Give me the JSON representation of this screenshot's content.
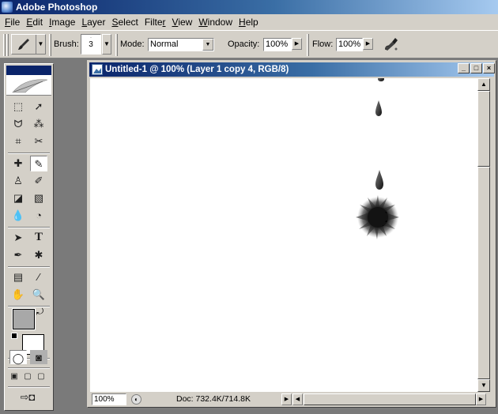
{
  "app": {
    "title": "Adobe Photoshop"
  },
  "menu": [
    {
      "pre": "",
      "u": "F",
      "post": "ile"
    },
    {
      "pre": "",
      "u": "E",
      "post": "dit"
    },
    {
      "pre": "",
      "u": "I",
      "post": "mage"
    },
    {
      "pre": "",
      "u": "L",
      "post": "ayer"
    },
    {
      "pre": "",
      "u": "S",
      "post": "elect"
    },
    {
      "pre": "Filte",
      "u": "r",
      "post": ""
    },
    {
      "pre": "",
      "u": "V",
      "post": "iew"
    },
    {
      "pre": "",
      "u": "W",
      "post": "indow"
    },
    {
      "pre": "",
      "u": "H",
      "post": "elp"
    }
  ],
  "options": {
    "brush_label": "Brush:",
    "brush_size": "3",
    "mode_label": "Mode:",
    "mode_value": "Normal",
    "opacity_label": "Opacity:",
    "opacity_value": "100%",
    "flow_label": "Flow:",
    "flow_value": "100%"
  },
  "document": {
    "title": "Untitled-1 @ 100% (Layer 1 copy 4, RGB/8)",
    "zoom": "100%",
    "doc_info": "Doc: 732.4K/714.8K"
  },
  "window_buttons": {
    "minimize": "_",
    "maximize": "□",
    "close": "×"
  },
  "toolbox": {
    "type_tool": "T"
  }
}
